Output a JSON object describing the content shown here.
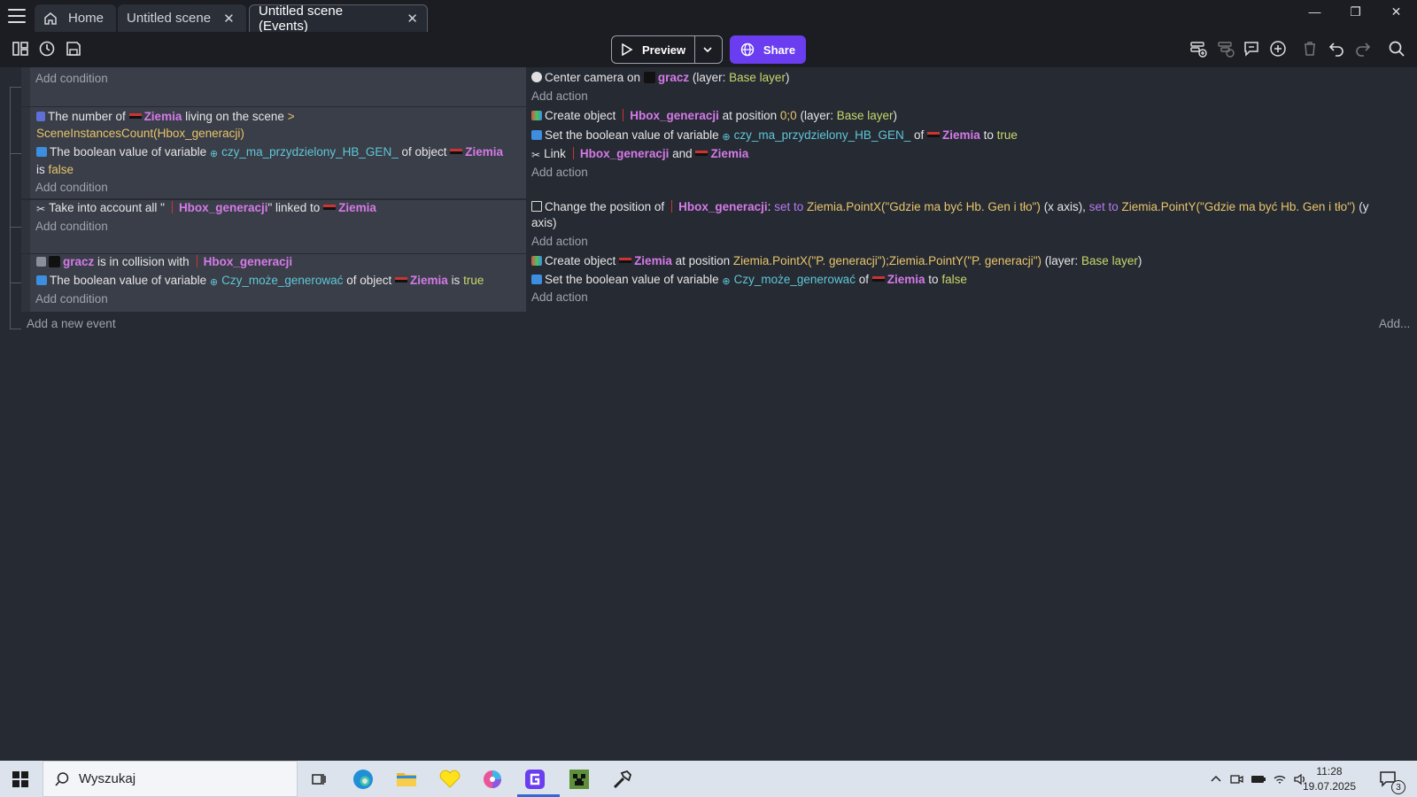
{
  "tabs": [
    {
      "label": "Home"
    },
    {
      "label": "Untitled scene"
    },
    {
      "label": "Untitled scene (Events)"
    }
  ],
  "toolbar": {
    "preview_label": "Preview",
    "share_label": "Share"
  },
  "events": {
    "e1": {
      "cond_add": "Add condition",
      "a1_prefix": "Center camera on",
      "a1_obj": "gracz",
      "a1_layer_pre": "(layer:",
      "a1_layer": "Base layer",
      "a1_layer_post": ")",
      "act_add": "Add action"
    },
    "e2": {
      "c1_pre": "The number of",
      "c1_obj": "Ziemia",
      "c1_mid": "living on the scene",
      "c1_op": ">",
      "c1_expr": "SceneInstancesCount(Hbox_generacji)",
      "c2_pre": "The boolean value of variable",
      "c2_var": "czy_ma_przydzielony_HB_GEN_",
      "c2_mid": "of object",
      "c2_obj": "Ziemia",
      "c2_is": "is",
      "c2_val": "false",
      "cond_add": "Add condition",
      "a1_pre": "Create object",
      "a1_obj": "Hbox_generacji",
      "a1_mid": "at position",
      "a1_pos": "0;0",
      "a1_layer_pre": "(layer:",
      "a1_layer": "Base layer",
      "a1_layer_post": ")",
      "a2_pre": "Set the boolean value of variable",
      "a2_var": "czy_ma_przydzielony_HB_GEN_",
      "a2_of": "of",
      "a2_obj": "Ziemia",
      "a2_to": "to",
      "a2_val": "true",
      "a3_pre": "Link",
      "a3_obj1": "Hbox_generacji",
      "a3_and": "and",
      "a3_obj2": "Ziemia",
      "act_add": "Add action"
    },
    "e3": {
      "c1_pre": "Take into account all \"",
      "c1_obj": "Hbox_generacji",
      "c1_mid": "\" linked to",
      "c1_obj2": "Ziemia",
      "cond_add": "Add condition",
      "a1_pre": "Change the position of",
      "a1_obj": "Hbox_generacji",
      "a1_colon": ":",
      "a1_set1": "set to",
      "a1_expr1": "Ziemia.PointX(\"Gdzie ma być Hb. Gen i tło\")",
      "a1_x": "(x axis),",
      "a1_set2": "set to",
      "a1_expr2": "Ziemia.PointY(\"Gdzie ma być Hb. Gen i tło\")",
      "a1_y1": "(y",
      "a1_y2": "axis)",
      "act_add": "Add action"
    },
    "e4": {
      "c1_obj": "gracz",
      "c1_mid": "is in collision with",
      "c1_obj2": "Hbox_generacji",
      "c2_pre": "The boolean value of variable",
      "c2_var": "Czy_może_generować",
      "c2_mid": "of object",
      "c2_obj": "Ziemia",
      "c2_is": "is",
      "c2_val": "true",
      "cond_add": "Add condition",
      "a1_pre": "Create object",
      "a1_obj": "Ziemia",
      "a1_mid": "at position",
      "a1_pos": "Ziemia.PointX(\"P. generacji\");Ziemia.PointY(\"P. generacji\")",
      "a1_layer_pre": "(layer:",
      "a1_layer": "Base layer",
      "a1_layer_post": ")",
      "a2_pre": "Set the boolean value of variable",
      "a2_var": "Czy_może_generować",
      "a2_of": "of",
      "a2_obj": "Ziemia",
      "a2_to": "to",
      "a2_val": "false",
      "act_add": "Add action"
    }
  },
  "add_event": "Add a new event",
  "add_more": "Add...",
  "taskbar": {
    "search_placeholder": "Wyszukaj",
    "time": "11:28",
    "date": "19.07.2025",
    "notifications": "3"
  }
}
